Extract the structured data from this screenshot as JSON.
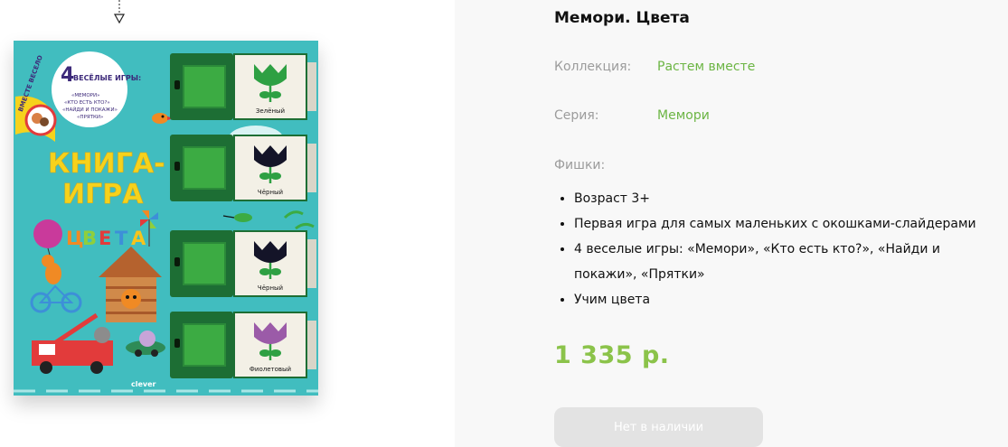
{
  "product": {
    "title": "Мемори. Цвета",
    "cover": {
      "badge_number": "4",
      "badge_title": "ВЕСЁЛЫЕ ИГРЫ:",
      "badge_games": [
        "«МЕМОРИ»",
        "«КТО ЕСТЬ КТО?»",
        "«НАЙДИ И ПОКАЖИ»",
        "«ПРЯТКИ»"
      ],
      "series_ribbon": "ВМЕСТЕ ВЕСЕЛО",
      "heading_line1": "КНИГА-",
      "heading_line2": "ИГРА",
      "subtitle_letters": [
        "Ц",
        "В",
        "Е",
        "Т",
        "А"
      ],
      "subtitle_colors": [
        "#f08a24",
        "#8fcf3c",
        "#e23b3b",
        "#3d8fd8",
        "#f6c41c"
      ],
      "slots": [
        {
          "label": "Зелёный",
          "color": "#2ea043"
        },
        {
          "label": "Чёрный",
          "color": "#141428"
        },
        {
          "label": "Чёрный",
          "color": "#141428"
        },
        {
          "label": "Фиолетовый",
          "color": "#9b5ba8"
        }
      ],
      "publisher": "clever"
    },
    "meta": [
      {
        "label": "Коллекция:",
        "value": "Растем вместе"
      },
      {
        "label": "Серия:",
        "value": "Мемори"
      }
    ],
    "features_label": "Фишки:",
    "features": [
      "Возраст 3+",
      "Первая игра для самых маленьких с окошками-слайдерами",
      "4 веселые игры: «Мемори», «Кто есть кто?», «Найди и покажи», «Прятки»",
      "Учим цвета"
    ],
    "price": "1 335 р.",
    "button_label": "Нет в наличии"
  },
  "colors": {
    "accent_green": "#6cb544",
    "price_green": "#8bc34a",
    "cover_teal": "#41bdbf",
    "cover_yellow": "#f6d21c"
  }
}
